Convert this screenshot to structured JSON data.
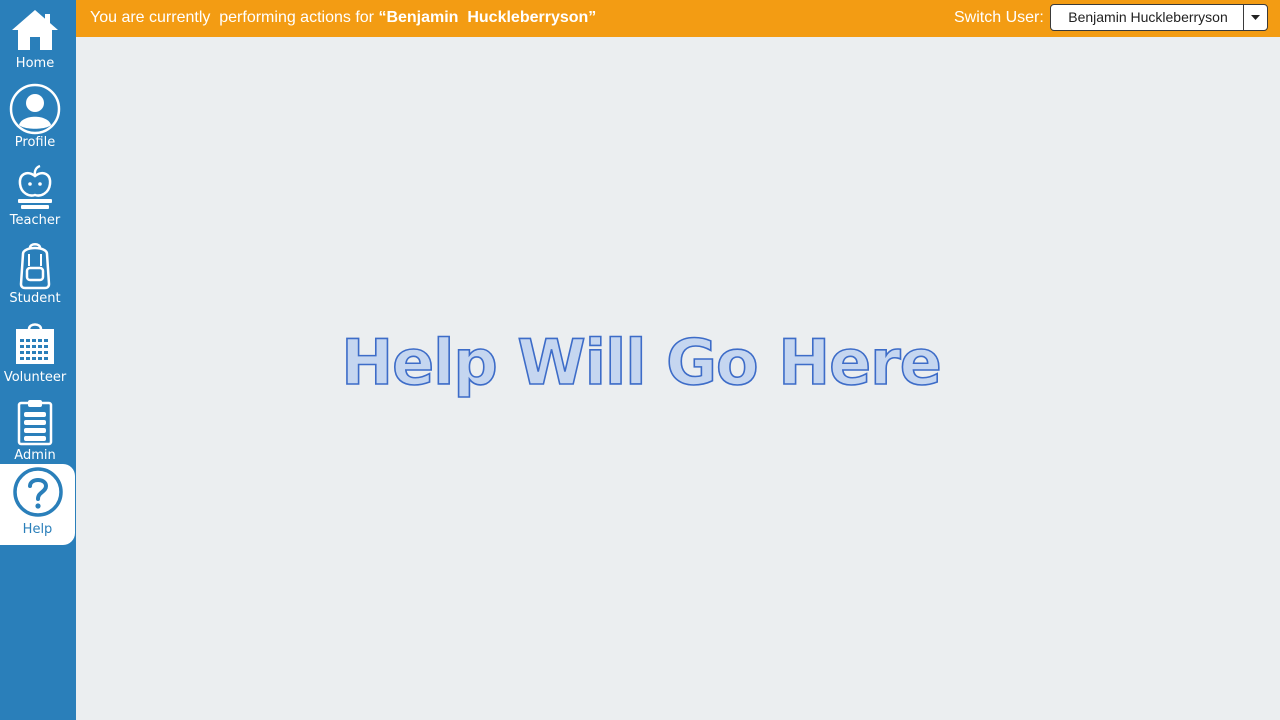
{
  "sidebar": {
    "items": [
      {
        "label": "Home",
        "icon": "home-icon"
      },
      {
        "label": "Profile",
        "icon": "user-circle-icon"
      },
      {
        "label": "Teacher",
        "icon": "apple-teacher-icon"
      },
      {
        "label": "Student",
        "icon": "backpack-icon"
      },
      {
        "label": "Volunteer",
        "icon": "calendar-icon"
      },
      {
        "label": "Admin",
        "icon": "clipboard-icon"
      },
      {
        "label": "Help",
        "icon": "help-question-icon",
        "active": true
      }
    ]
  },
  "header": {
    "acting_prefix": "You are currently  performing actions for ",
    "acting_user": "“Benjamin  Huckleberryson”",
    "switch_label": "Switch User:",
    "selected_user": "Benjamin Huckleberryson"
  },
  "main": {
    "heading": "Help Will Go Here"
  },
  "colors": {
    "sidebar": "#2a7fba",
    "topbar": "#f39c13",
    "background": "#ebeef0",
    "heading_stroke": "#3d6cc8"
  }
}
